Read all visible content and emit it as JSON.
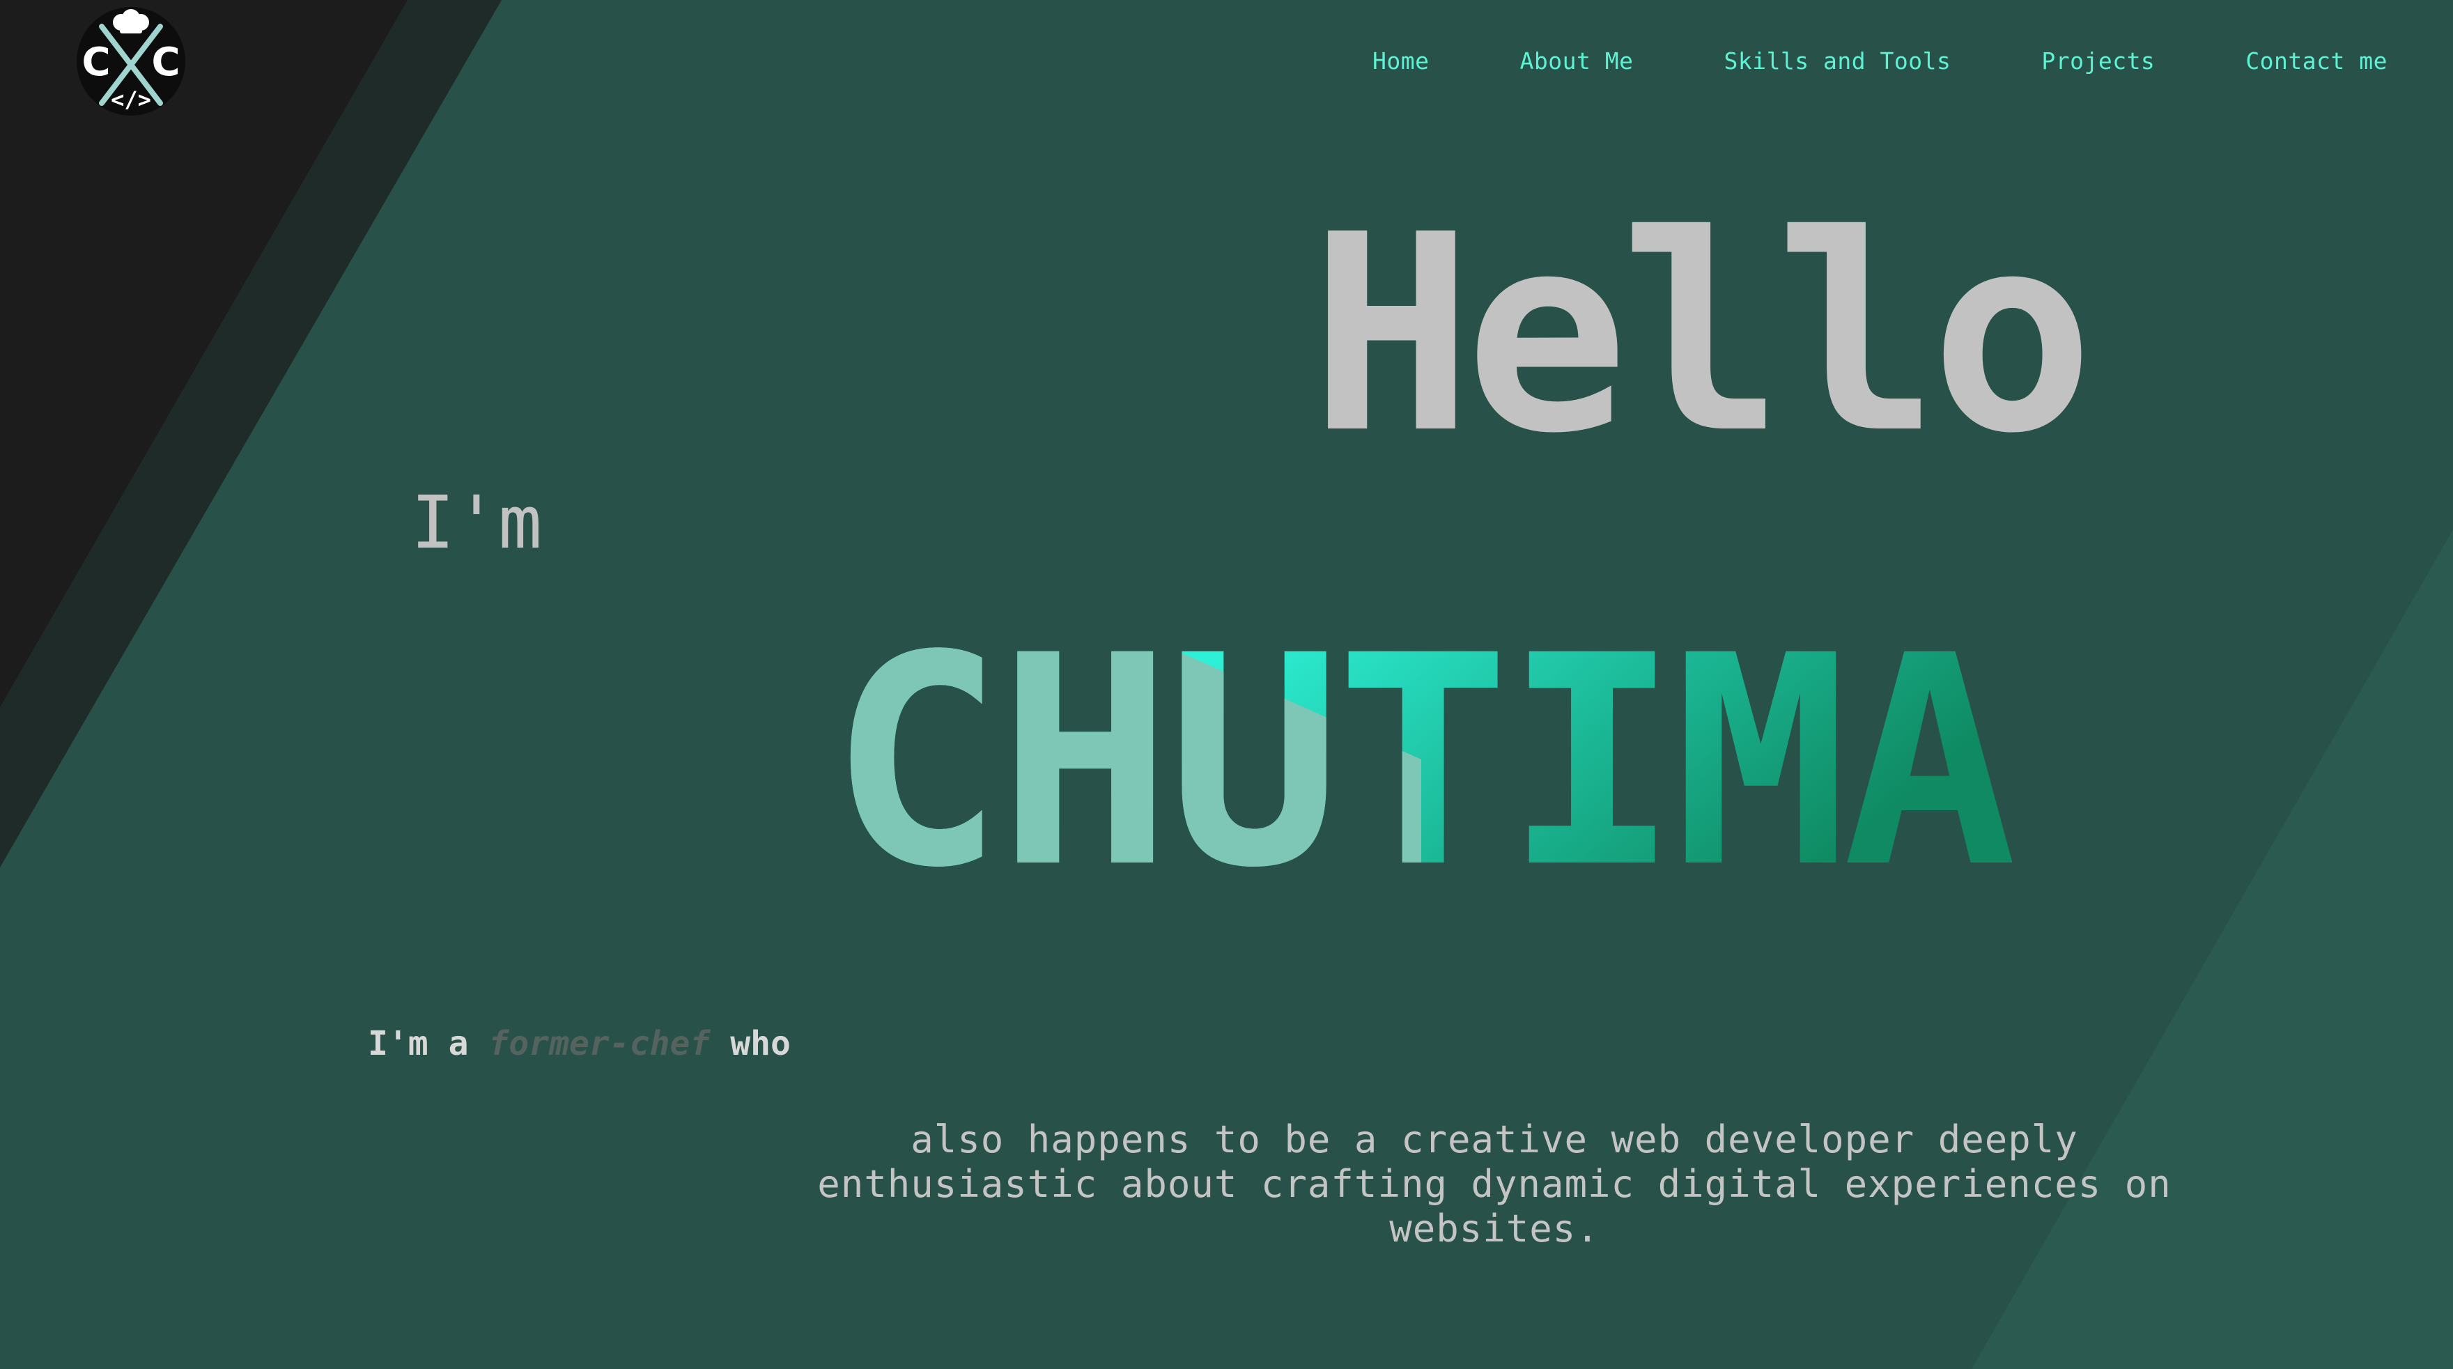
{
  "logo": {
    "letters_left": "C",
    "letters_right": "C",
    "code_symbol": "</>",
    "icon": "chef-hat-code-logo-icon"
  },
  "nav": {
    "items": [
      {
        "label": "Home"
      },
      {
        "label": "About Me"
      },
      {
        "label": "Skills and Tools"
      },
      {
        "label": "Projects"
      },
      {
        "label": "Contact me"
      }
    ]
  },
  "hero": {
    "greeting": "Hello",
    "intro": "I'm",
    "name": "CHUTIMA"
  },
  "tagline": {
    "prefix": "I'm a",
    "highlight": "former-chef",
    "suffix": "who"
  },
  "description": "also happens to be a creative web developer deeply enthusiastic about crafting dynamic digital experiences on websites.",
  "colors": {
    "background": "#285149",
    "dark_corner": "#1c1c1c",
    "stripe": "#1f2b28",
    "accent": "#5ef2d4",
    "name_gradient_start": "#2ef5d9",
    "name_gradient_end": "#0f8a62",
    "text_light": "#c2c2c2"
  }
}
